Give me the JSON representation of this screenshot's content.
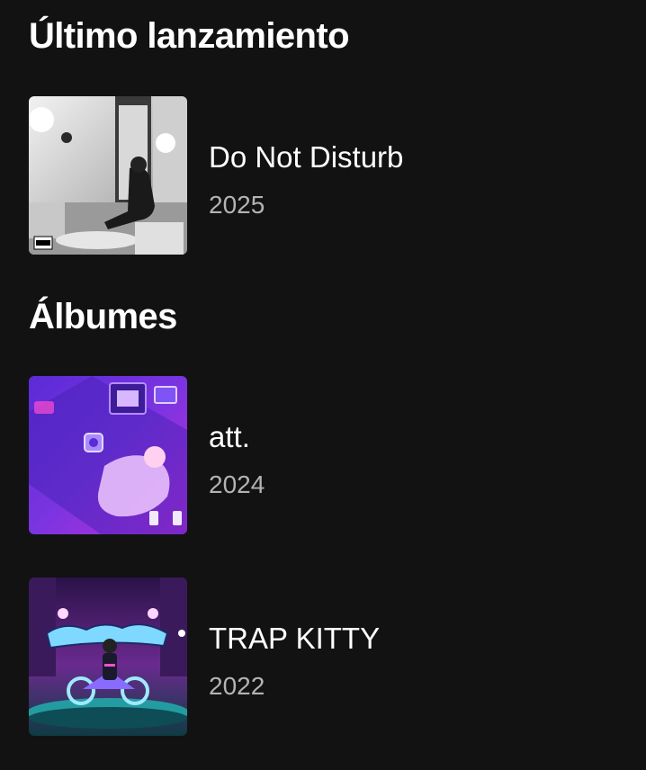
{
  "latest_release": {
    "heading": "Último lanzamiento",
    "item": {
      "title": "Do Not Disturb",
      "year": "2025",
      "cover_style": "black-and-white photo, woman seated on sofa by window",
      "explicit_badge": true
    }
  },
  "albums": {
    "heading": "Álbumes",
    "items": [
      {
        "title": "att.",
        "year": "2024",
        "cover_style": "purple neon illustration of a room from above"
      },
      {
        "title": "TRAP KITTY",
        "year": "2022",
        "cover_style": "neon cyan/purple scene with rider on motorcycle and graffiti logo"
      }
    ]
  },
  "colors": {
    "background": "#121212",
    "title_text": "#ffffff",
    "subtitle_text": "#b3b3b3"
  }
}
